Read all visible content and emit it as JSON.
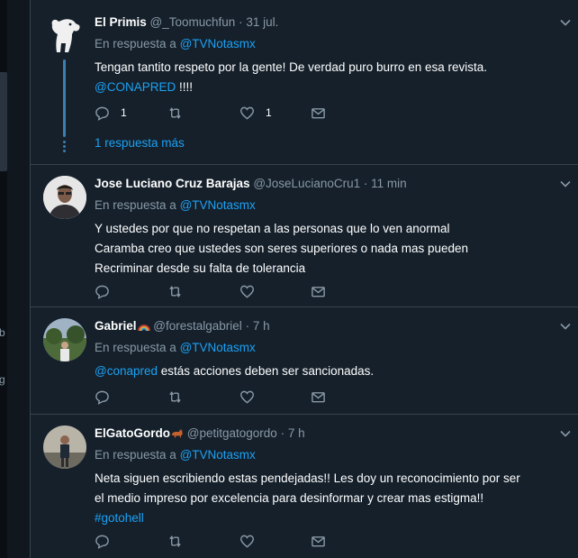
{
  "colors": {
    "background": "#15202b",
    "text": "#ffffff",
    "secondary": "#8899a6",
    "link": "#1da1f2",
    "divider": "#38444d"
  },
  "left_fragments": [
    "b",
    "g"
  ],
  "tweets": [
    {
      "name": "El Primis",
      "handle": "@_Toomuchfun",
      "dot": "·",
      "time": "31 jul.",
      "reply_prefix": "En respuesta a",
      "reply_to": "@TVNotasmx",
      "text_line1": "Tengan tantito respeto por la gente! De verdad puro burro en esa revista.",
      "mention": "@CONAPRED",
      "text_line2_tail": " !!!!",
      "reply_count": "1",
      "like_count": "1",
      "more_replies": "1 respuesta más",
      "avatar_icon": "dog-icon"
    },
    {
      "name": "Jose Luciano Cruz Barajas",
      "handle": "@JoseLucianoCru1",
      "dot": "·",
      "time": "11 min",
      "reply_prefix": "En respuesta a",
      "reply_to": "@TVNotasmx",
      "line1": "Y ustedes por que no respetan  a las personas que lo ven  anormal",
      "line2": "Caramba creo que ustedes son seres superiores o nada mas pueden",
      "line3": "Recriminar desde su falta de tolerancia"
    },
    {
      "name": "Gabriel",
      "name_emoji": "rainbow-emoji",
      "handle": "@forestalgabriel",
      "dot": "·",
      "time": "7 h",
      "reply_prefix": "En respuesta a",
      "reply_to": "@TVNotasmx",
      "mention": "@conapred",
      "text_tail": " estás acciones deben ser sancionadas."
    },
    {
      "name": "ElGatoGordo",
      "name_emoji": "cat-emoji",
      "handle": "@petitgatogordo",
      "dot": "·",
      "time": "7 h",
      "reply_prefix": "En respuesta a",
      "reply_to": "@TVNotasmx",
      "line1": "Neta siguen escribiendo estas pendejadas!! Les doy un reconocimiento por ser",
      "line2": "el medio impreso por excelencia para desinformar y crear mas estigma!!",
      "hashtag": "#gotohell"
    }
  ]
}
